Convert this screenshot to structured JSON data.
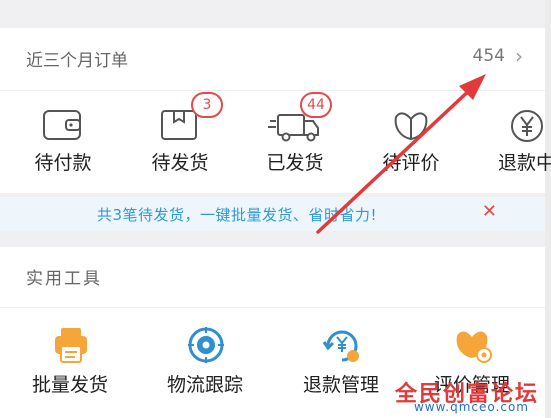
{
  "orders": {
    "title": "近三个月订单",
    "count": "454",
    "chevron_icon": "chevron-right-icon"
  },
  "status": [
    {
      "label": "待付款",
      "icon": "wallet-icon",
      "badge": ""
    },
    {
      "label": "待发货",
      "icon": "package-icon",
      "badge": "3"
    },
    {
      "label": "已发货",
      "icon": "truck-icon",
      "badge": "44"
    },
    {
      "label": "待评价",
      "icon": "flower-icon",
      "badge": ""
    },
    {
      "label": "退款中",
      "icon": "yen-icon",
      "badge": ""
    }
  ],
  "tip": {
    "text": "共3笔待发货，一键批量发货、省时省力!",
    "close_icon": "close-icon"
  },
  "tools": {
    "title": "实用工具",
    "items": [
      {
        "label": "批量发货",
        "icon": "printer-icon"
      },
      {
        "label": "物流跟踪",
        "icon": "target-icon"
      },
      {
        "label": "退款管理",
        "icon": "refund-icon"
      },
      {
        "label": "评价管理",
        "icon": "flower-gear-icon"
      }
    ]
  },
  "watermark": {
    "name": "全民创富论坛",
    "url": "www.qmceo.com"
  },
  "colors": {
    "badge": "#e24b4b",
    "tip_text": "#2e9ad8",
    "tool_orange": "#f5a53a",
    "tool_blue": "#2f8fd0",
    "arrow": "#e23a3a"
  }
}
